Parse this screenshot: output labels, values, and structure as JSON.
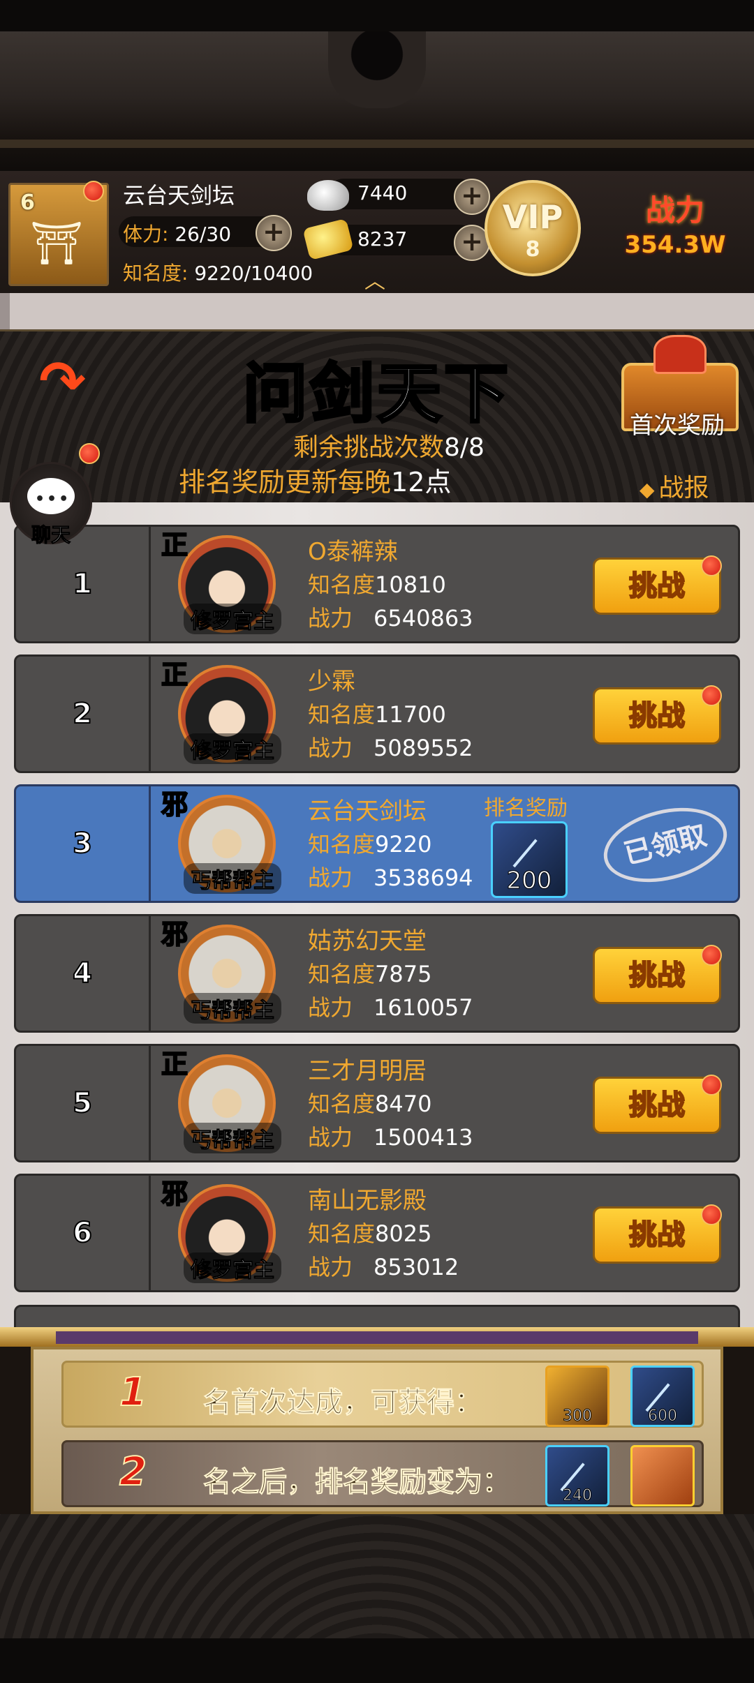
{
  "header": {
    "level": "6",
    "player_name": "云台天剑坛",
    "stamina_label": "体力:",
    "stamina_value": "26/30",
    "fame_label": "知名度:",
    "fame_value": "9220/10400",
    "silver": "7440",
    "gold": "8237",
    "vip_text": "VIP",
    "vip_level": "8",
    "combat_label": "战力",
    "combat_value": "354.3W",
    "plus": "+"
  },
  "banner": {
    "title": "问剑天下",
    "remaining_label": "剩余挑战次数",
    "remaining_value": "8/8",
    "reset_label": "排名奖励更新每晚",
    "reset_value": "12点",
    "first_reward": "首次奖励",
    "battle_report": "战报",
    "chat": "聊天"
  },
  "labels": {
    "fame": "知名度",
    "power": "战力",
    "challenge": "挑战",
    "rank_reward": "排名奖励",
    "claimed": "已领取"
  },
  "rankings": [
    {
      "rank": "1",
      "faction": "正",
      "role": "修罗宫主",
      "name": "O泰裤辣",
      "fame": "10810",
      "power": "6540863"
    },
    {
      "rank": "2",
      "faction": "正",
      "role": "修罗宫主",
      "name": "少霖",
      "fame": "11700",
      "power": "5089552"
    },
    {
      "rank": "3",
      "faction": "邪",
      "role": "丐帮帮主",
      "name": "云台天剑坛",
      "fame": "9220",
      "power": "3538694",
      "reward_count": "200"
    },
    {
      "rank": "4",
      "faction": "邪",
      "role": "丐帮帮主",
      "name": "姑苏幻天堂",
      "fame": "7875",
      "power": "1610057"
    },
    {
      "rank": "5",
      "faction": "正",
      "role": "丐帮帮主",
      "name": "三才月明居",
      "fame": "8470",
      "power": "1500413"
    },
    {
      "rank": "6",
      "faction": "邪",
      "role": "修罗宫主",
      "name": "南山无影殿",
      "fame": "8025",
      "power": "853012"
    }
  ],
  "panel": {
    "line1_rank": "1",
    "line1_text": "名首次达成，可获得：",
    "line1_item1": "300",
    "line1_item2": "600",
    "line2_rank": "2",
    "line2_text": "名之后，排名奖励变为：",
    "line2_item1": "240"
  },
  "colors": {
    "accent_gold": "#f0a830",
    "row_default": "#4f4d4c",
    "row_self": "#4a78bd",
    "button_yellow": "#ffd23a"
  }
}
